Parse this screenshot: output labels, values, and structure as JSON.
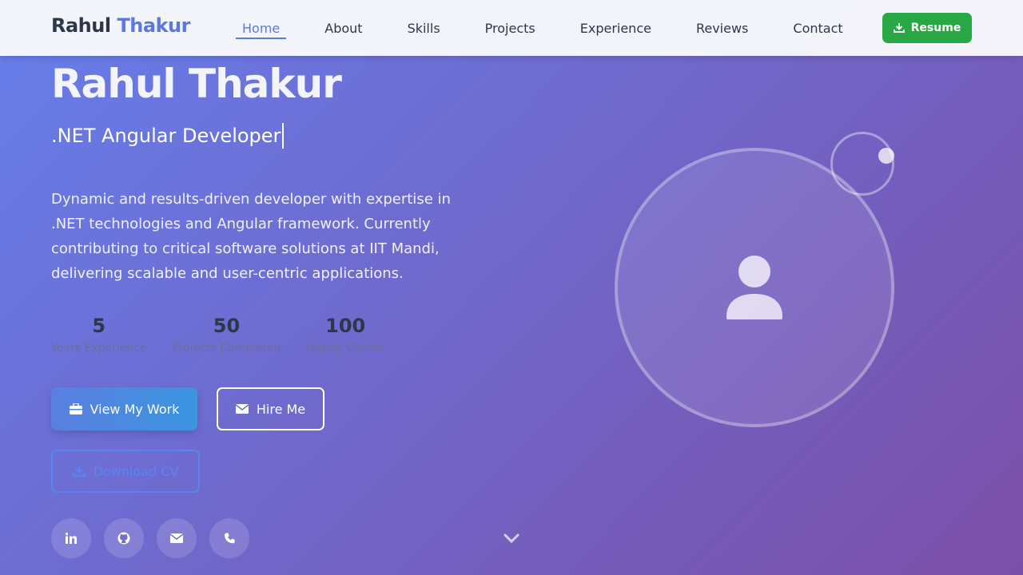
{
  "nav": {
    "brand_first": "Rahul",
    "brand_last": "Thakur",
    "links": [
      {
        "label": "Home",
        "active": true
      },
      {
        "label": "About"
      },
      {
        "label": "Skills"
      },
      {
        "label": "Projects"
      },
      {
        "label": "Experience"
      },
      {
        "label": "Reviews"
      },
      {
        "label": "Contact"
      }
    ],
    "resume_label": "Resume",
    "resume_icon": "download-icon"
  },
  "hero": {
    "name": "Rahul Thakur",
    "role": ".NET Angular Developer",
    "description": "Dynamic and results-driven developer with expertise in .NET technologies and Angular framework. Currently contributing to critical software solutions at IIT Mandi, delivering scalable and user-centric applications.",
    "stats": [
      {
        "value": "5",
        "label": "Years Experience"
      },
      {
        "value": "50",
        "label": "Projects Completed"
      },
      {
        "value": "100",
        "label": "Happy Clients"
      }
    ],
    "primary_button": "View My Work",
    "secondary_button": "Hire Me",
    "cv_button": "Download CV"
  },
  "socials": [
    "linkedin-icon",
    "github-icon",
    "email-icon",
    "phone-icon"
  ],
  "colors": {
    "accent": "#5a78e0",
    "resume_green": "#28a745",
    "gradient_start": "#667eea",
    "gradient_end": "#7b4fa8"
  }
}
